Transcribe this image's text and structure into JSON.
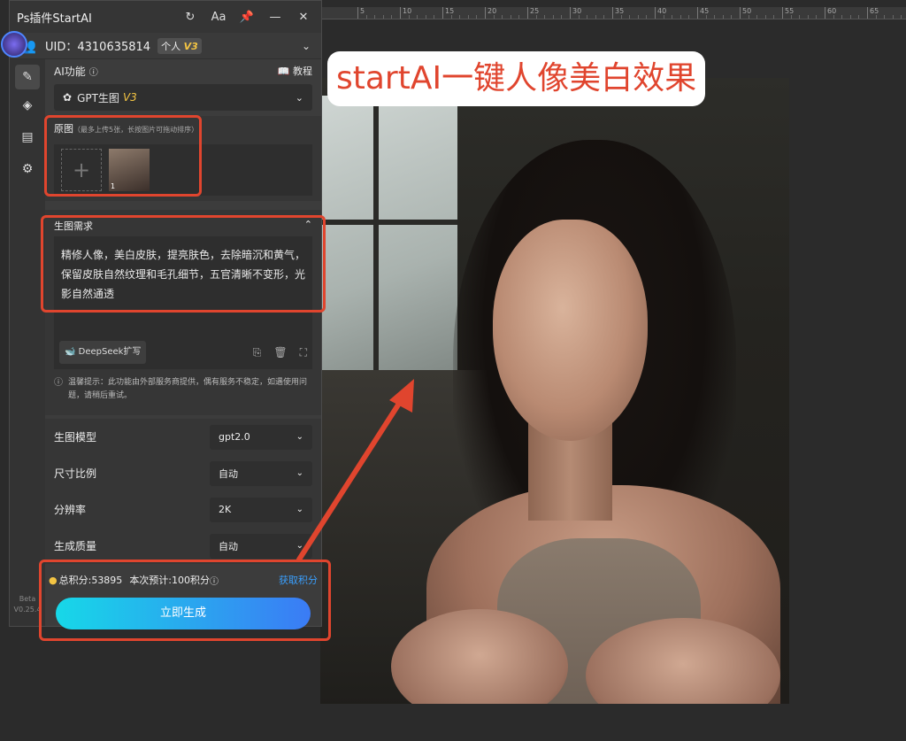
{
  "panel": {
    "title": "Ps插件StartAI",
    "title_icons": [
      "refresh-icon",
      "font-size-icon",
      "pin-icon",
      "minimize-icon",
      "close-icon"
    ],
    "uid": "UID：4310635814",
    "account_tag": "个人",
    "account_level": "V3"
  },
  "ai_function": {
    "label": "AI功能",
    "tutorial": "教程",
    "model_select": "GPT生图",
    "model_level": "V3"
  },
  "original": {
    "label": "原图",
    "hint": "（最多上传5张，长按图片可拖动排序）",
    "thumb_index": "1"
  },
  "prompt": {
    "label": "生图需求",
    "text": "精修人像，美白皮肤，提亮肤色，去除暗沉和黄气，保留皮肤自然纹理和毛孔细节，五官清晰不变形，光影自然通透",
    "deepseek": "DeepSeek扩写"
  },
  "tip": {
    "text": "温馨提示：此功能由外部服务商提供，偶有服务不稳定，如遇使用问题，请稍后重试。"
  },
  "params": [
    {
      "label": "生图模型",
      "value": "gpt2.0"
    },
    {
      "label": "尺寸比例",
      "value": "自动"
    },
    {
      "label": "分辨率",
      "value": "2K"
    },
    {
      "label": "生成质量",
      "value": "自动"
    }
  ],
  "points": {
    "total": "总积分:53895",
    "estimate": "本次预计:100积分",
    "get": "获取积分"
  },
  "generate_button": "立即生成",
  "beta": {
    "label": "Beta",
    "version": "V0.25.4"
  },
  "headline": "startAI一键人像美白效果",
  "ruler": [
    "5",
    "10",
    "15",
    "20",
    "25",
    "30",
    "35",
    "40",
    "45",
    "50",
    "55",
    "60",
    "65"
  ],
  "colors": {
    "annotation": "#e0452e",
    "accent": "#3b7bf5",
    "gold": "#f3c443"
  }
}
